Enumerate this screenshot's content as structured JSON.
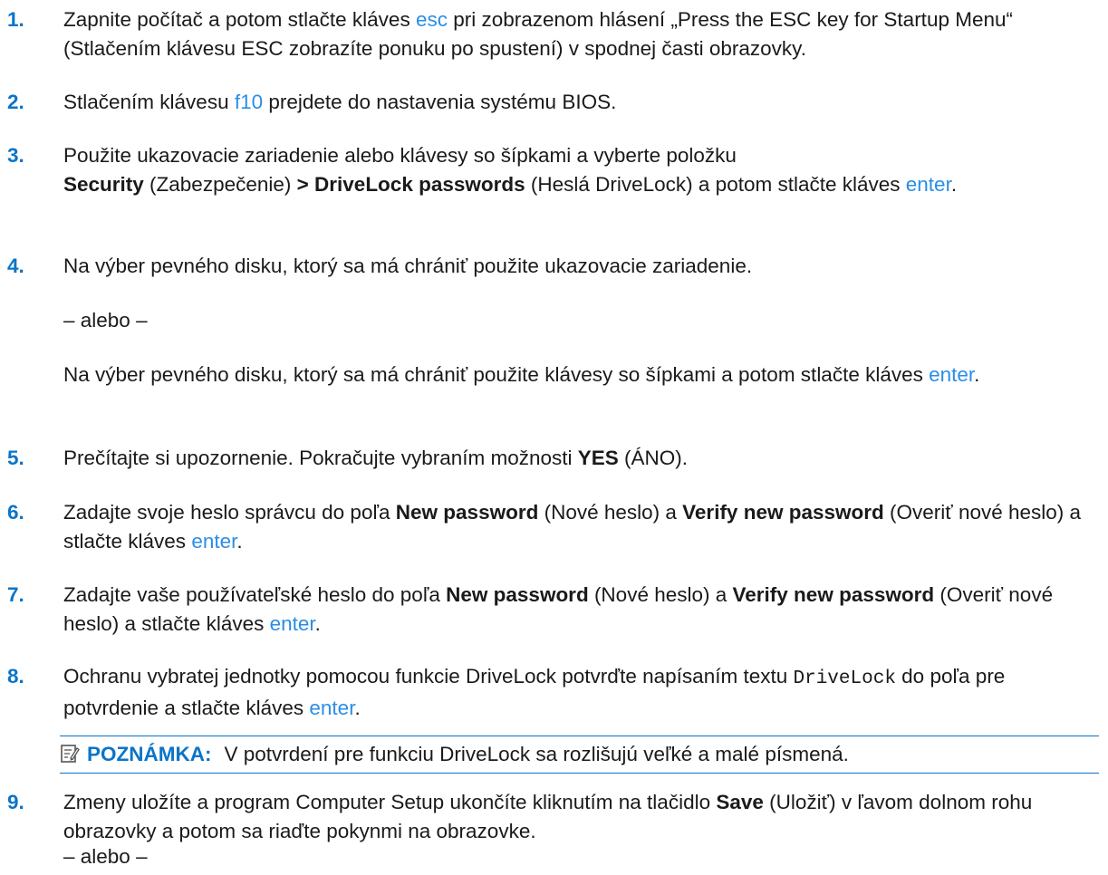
{
  "steps": [
    {
      "num": "1.",
      "p1": "Zapnite počítač a potom stlačte kláves ",
      "k1": "esc",
      "p2": " pri zobrazenom hlásení „Press the ESC key for Startup Menu“ (Stlačením klávesu ESC zobrazíte ponuku po spustení) v spodnej časti obrazovky."
    },
    {
      "num": "2.",
      "p1": "Stlačením klávesu ",
      "k1": "f10",
      "p2": " prejdete do nastavenia systému BIOS."
    },
    {
      "num": "3.",
      "p1": "Použite ukazovacie zariadenie alebo klávesy so šípkami a vyberte položku",
      "b1": "Security",
      "p2": " (Zabezpečenie) ",
      "b2": "> DriveLock passwords",
      "p3": " (Heslá DriveLock) a potom stlačte kláves ",
      "k1": "enter",
      "p4": "."
    },
    {
      "num": "4.",
      "p1": "Na výber pevného disku, ktorý sa má chrániť použite ukazovacie zariadenie.",
      "or": "– alebo –",
      "p2": "Na výber pevného disku, ktorý sa má chrániť použite klávesy so šípkami a potom stlačte kláves ",
      "k1": "enter",
      "p3": "."
    },
    {
      "num": "5.",
      "p1": "Prečítajte si upozornenie. Pokračujte vybraním možnosti ",
      "b1": "YES",
      "p2": " (ÁNO)."
    },
    {
      "num": "6.",
      "p1": "Zadajte svoje heslo správcu do poľa ",
      "b1": "New password",
      "p2": " (Nové heslo) a ",
      "b2": "Verify new password",
      "p3": " (Overiť nové heslo) a stlačte kláves ",
      "k1": "enter",
      "p4": "."
    },
    {
      "num": "7.",
      "p1": "Zadajte vaše používateľské heslo do poľa ",
      "b1": "New password",
      "p2": " (Nové heslo) a ",
      "b2": "Verify new password",
      "p3": " (Overiť nové heslo) a stlačte kláves ",
      "k1": "enter",
      "p4": "."
    },
    {
      "num": "8.",
      "p1": "Ochranu vybratej jednotky pomocou funkcie DriveLock potvrďte napísaním textu ",
      "m1": "DriveLock",
      "p2": " do poľa pre potvrdenie a stlačte kláves ",
      "k1": "enter",
      "p3": "."
    },
    {
      "num": "9.",
      "p1": "Zmeny uložíte a program Computer Setup ukončíte kliknutím na tlačidlo ",
      "b1": "Save",
      "p2": " (Uložiť) v ľavom dolnom rohu obrazovky a potom sa riaďte pokynmi na obrazovke.",
      "or": "– alebo –"
    }
  ],
  "note": {
    "label": "POZNÁMKA:",
    "text": "V potvrdení pre funkciu DriveLock sa rozlišujú veľké a malé písmená.",
    "icon": "note-pencil-icon"
  },
  "colors": {
    "accent": "#0a74c9",
    "key": "#2a8ee6",
    "text": "#1a1a1a"
  }
}
